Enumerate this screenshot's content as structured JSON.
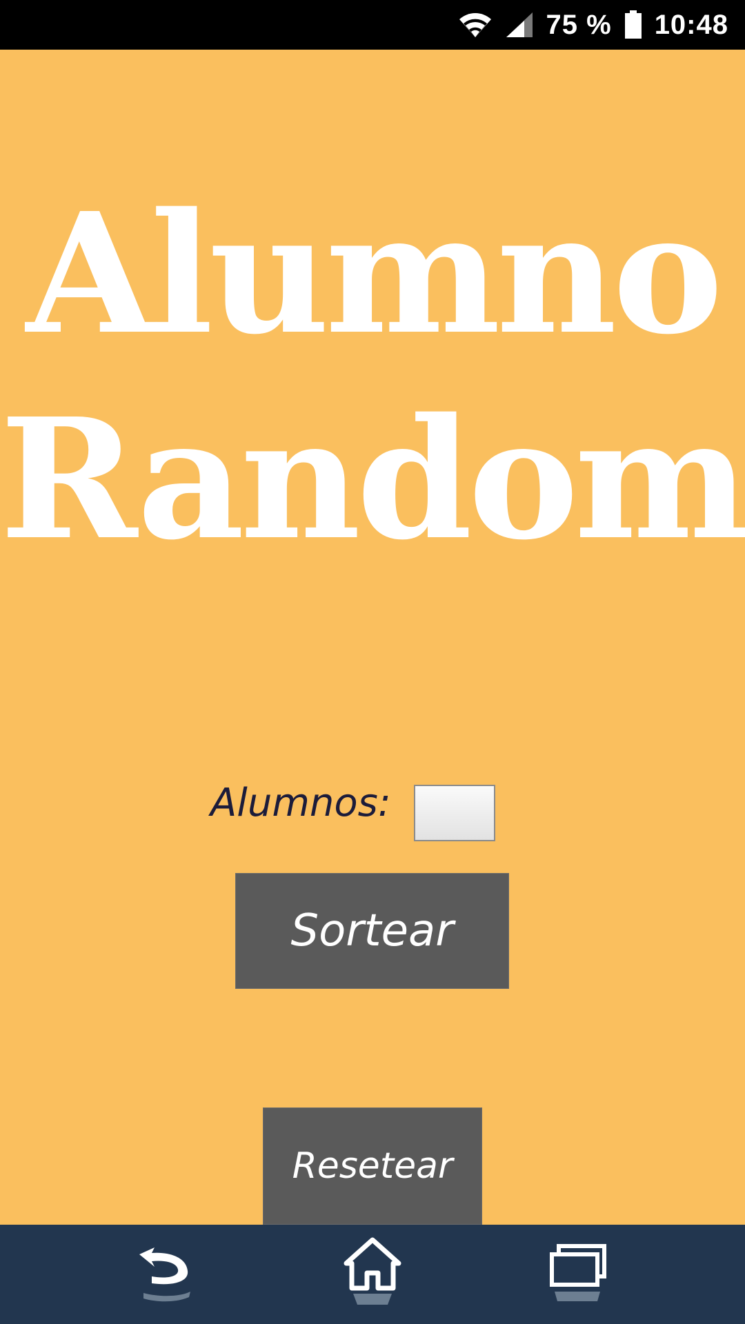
{
  "status_bar": {
    "battery_percent": "75 %",
    "time": "10:48",
    "icons": [
      "wifi-icon",
      "cell-signal-icon",
      "battery-icon"
    ]
  },
  "title": {
    "line1": "Alumno",
    "line2": "Random"
  },
  "form": {
    "alumnos_label": "Alumnos:",
    "alumnos_value": ""
  },
  "buttons": {
    "sortear_label": "Sortear",
    "resetear_label": "Resetear"
  },
  "nav_bar": {
    "icons": [
      "back-icon",
      "home-icon",
      "recents-icon"
    ]
  },
  "colors": {
    "background": "#fabf5e",
    "button": "#5a5a5a",
    "nav_bar": "#22364f",
    "status_bar": "#000000",
    "label_text": "#1c1c3a"
  }
}
